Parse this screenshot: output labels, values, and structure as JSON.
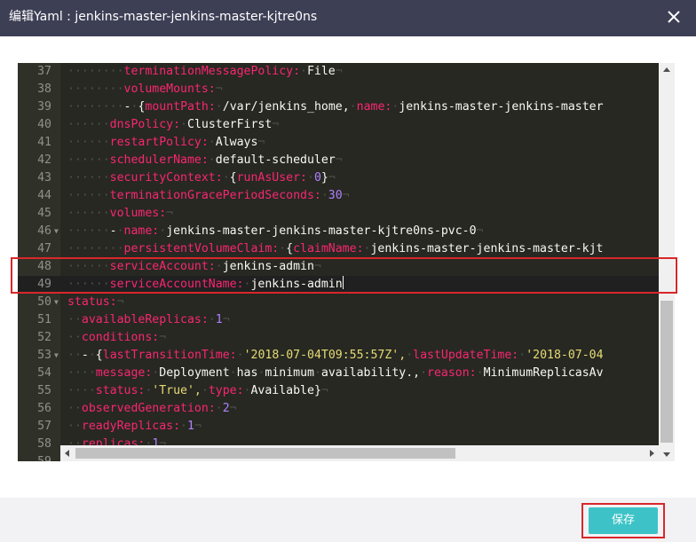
{
  "dialog": {
    "title": "编辑Yaml : jenkins-master-jenkins-master-kjtre0ns",
    "close_icon": "close-icon",
    "save_label": "保存",
    "accent_color": "#3dc3c7",
    "annotation_color": "#d9272a"
  },
  "editor": {
    "theme": "monokai",
    "cursor_line": "49",
    "lines": [
      {
        "num": "37",
        "fold": false,
        "partial": false,
        "tokens": [
          [
            "e",
            "········"
          ],
          [
            "k",
            "terminationMessagePolicy:"
          ],
          [
            "e",
            "·"
          ],
          [
            "v",
            "File"
          ],
          [
            "e",
            "¬"
          ]
        ]
      },
      {
        "num": "38",
        "fold": false,
        "partial": false,
        "tokens": [
          [
            "e",
            "········"
          ],
          [
            "k",
            "volumeMounts:"
          ],
          [
            "e",
            "¬"
          ]
        ]
      },
      {
        "num": "39",
        "fold": false,
        "partial": false,
        "tokens": [
          [
            "e",
            "········"
          ],
          [
            "p",
            "-"
          ],
          [
            "e",
            "·"
          ],
          [
            "p",
            "{"
          ],
          [
            "k",
            "mountPath:"
          ],
          [
            "e",
            "·"
          ],
          [
            "v",
            "/var/jenkins_home,"
          ],
          [
            "e",
            "·"
          ],
          [
            "k",
            "name:"
          ],
          [
            "e",
            "·"
          ],
          [
            "v",
            "jenkins-master-jenkins-master"
          ]
        ]
      },
      {
        "num": "40",
        "fold": false,
        "partial": false,
        "tokens": [
          [
            "e",
            "······"
          ],
          [
            "k",
            "dnsPolicy:"
          ],
          [
            "e",
            "·"
          ],
          [
            "v",
            "ClusterFirst"
          ],
          [
            "e",
            "¬"
          ]
        ]
      },
      {
        "num": "41",
        "fold": false,
        "partial": false,
        "tokens": [
          [
            "e",
            "······"
          ],
          [
            "k",
            "restartPolicy:"
          ],
          [
            "e",
            "·"
          ],
          [
            "v",
            "Always"
          ],
          [
            "e",
            "¬"
          ]
        ]
      },
      {
        "num": "42",
        "fold": false,
        "partial": false,
        "tokens": [
          [
            "e",
            "······"
          ],
          [
            "k",
            "schedulerName:"
          ],
          [
            "e",
            "·"
          ],
          [
            "v",
            "default-scheduler"
          ],
          [
            "e",
            "¬"
          ]
        ]
      },
      {
        "num": "43",
        "fold": false,
        "partial": false,
        "tokens": [
          [
            "e",
            "······"
          ],
          [
            "k",
            "securityContext:"
          ],
          [
            "e",
            "·"
          ],
          [
            "p",
            "{"
          ],
          [
            "k",
            "runAsUser:"
          ],
          [
            "e",
            "·"
          ],
          [
            "n",
            "0"
          ],
          [
            "p",
            "}"
          ],
          [
            "e",
            "¬"
          ]
        ]
      },
      {
        "num": "44",
        "fold": false,
        "partial": false,
        "tokens": [
          [
            "e",
            "······"
          ],
          [
            "k",
            "terminationGracePeriodSeconds:"
          ],
          [
            "e",
            "·"
          ],
          [
            "n",
            "30"
          ],
          [
            "e",
            "¬"
          ]
        ]
      },
      {
        "num": "45",
        "fold": false,
        "partial": false,
        "tokens": [
          [
            "e",
            "······"
          ],
          [
            "k",
            "volumes:"
          ],
          [
            "e",
            "¬"
          ]
        ]
      },
      {
        "num": "46",
        "fold": true,
        "partial": false,
        "tokens": [
          [
            "e",
            "······"
          ],
          [
            "p",
            "-"
          ],
          [
            "e",
            "·"
          ],
          [
            "k",
            "name:"
          ],
          [
            "e",
            "·"
          ],
          [
            "v",
            "jenkins-master-jenkins-master-kjtre0ns-pvc-0"
          ],
          [
            "e",
            "¬"
          ]
        ]
      },
      {
        "num": "47",
        "fold": false,
        "partial": false,
        "tokens": [
          [
            "e",
            "········"
          ],
          [
            "k",
            "persistentVolumeClaim:"
          ],
          [
            "e",
            "·"
          ],
          [
            "p",
            "{"
          ],
          [
            "k",
            "claimName:"
          ],
          [
            "e",
            "·"
          ],
          [
            "v",
            "jenkins-master-jenkins-master-kjt"
          ]
        ]
      },
      {
        "num": "48",
        "fold": false,
        "partial": false,
        "tokens": [
          [
            "e",
            "······"
          ],
          [
            "k",
            "serviceAccount:"
          ],
          [
            "e",
            "·"
          ],
          [
            "v",
            "jenkins-admin"
          ],
          [
            "e",
            "¬"
          ]
        ]
      },
      {
        "num": "49",
        "fold": false,
        "partial": false,
        "tokens": [
          [
            "e",
            "······"
          ],
          [
            "k",
            "serviceAccountName:"
          ],
          [
            "e",
            "·"
          ],
          [
            "v",
            "jenkins-admin"
          ]
        ]
      },
      {
        "num": "50",
        "fold": true,
        "partial": false,
        "tokens": [
          [
            "k",
            "status:"
          ],
          [
            "e",
            "¬"
          ]
        ]
      },
      {
        "num": "51",
        "fold": false,
        "partial": false,
        "tokens": [
          [
            "e",
            "··"
          ],
          [
            "k",
            "availableReplicas:"
          ],
          [
            "e",
            "·"
          ],
          [
            "n",
            "1"
          ],
          [
            "e",
            "¬"
          ]
        ]
      },
      {
        "num": "52",
        "fold": false,
        "partial": false,
        "tokens": [
          [
            "e",
            "··"
          ],
          [
            "k",
            "conditions:"
          ],
          [
            "e",
            "¬"
          ]
        ]
      },
      {
        "num": "53",
        "fold": true,
        "partial": false,
        "tokens": [
          [
            "e",
            "··"
          ],
          [
            "p",
            "-"
          ],
          [
            "e",
            "·"
          ],
          [
            "p",
            "{"
          ],
          [
            "k",
            "lastTransitionTime:"
          ],
          [
            "e",
            "·"
          ],
          [
            "s",
            "'2018-07-04T09:55:57Z',"
          ],
          [
            "e",
            "·"
          ],
          [
            "k",
            "lastUpdateTime:"
          ],
          [
            "e",
            "·"
          ],
          [
            "s",
            "'2018-07-04"
          ]
        ]
      },
      {
        "num": "54",
        "fold": false,
        "partial": false,
        "tokens": [
          [
            "e",
            "····"
          ],
          [
            "k",
            "message:"
          ],
          [
            "e",
            "·"
          ],
          [
            "v",
            "Deployment"
          ],
          [
            "e",
            "·"
          ],
          [
            "v",
            "has"
          ],
          [
            "e",
            "·"
          ],
          [
            "v",
            "minimum"
          ],
          [
            "e",
            "·"
          ],
          [
            "v",
            "availability.,"
          ],
          [
            "e",
            "·"
          ],
          [
            "k",
            "reason:"
          ],
          [
            "e",
            "·"
          ],
          [
            "v",
            "MinimumReplicasAv"
          ]
        ]
      },
      {
        "num": "55",
        "fold": false,
        "partial": false,
        "tokens": [
          [
            "e",
            "····"
          ],
          [
            "k",
            "status:"
          ],
          [
            "e",
            "·"
          ],
          [
            "s",
            "'True',"
          ],
          [
            "e",
            "·"
          ],
          [
            "k",
            "type:"
          ],
          [
            "e",
            "·"
          ],
          [
            "v",
            "Available"
          ],
          [
            "p",
            "}"
          ],
          [
            "e",
            "¬"
          ]
        ]
      },
      {
        "num": "56",
        "fold": false,
        "partial": false,
        "tokens": [
          [
            "e",
            "··"
          ],
          [
            "k",
            "observedGeneration:"
          ],
          [
            "e",
            "·"
          ],
          [
            "n",
            "2"
          ],
          [
            "e",
            "¬"
          ]
        ]
      },
      {
        "num": "57",
        "fold": false,
        "partial": false,
        "tokens": [
          [
            "e",
            "··"
          ],
          [
            "k",
            "readyReplicas:"
          ],
          [
            "e",
            "·"
          ],
          [
            "n",
            "1"
          ],
          [
            "e",
            "¬"
          ]
        ]
      },
      {
        "num": "58",
        "fold": false,
        "partial": false,
        "tokens": [
          [
            "e",
            "··"
          ],
          [
            "k",
            "replicas:"
          ],
          [
            "e",
            "·"
          ],
          [
            "n",
            "1"
          ],
          [
            "e",
            "¬"
          ]
        ]
      },
      {
        "num": "59",
        "fold": false,
        "partial": true,
        "tokens": []
      }
    ]
  },
  "scrollbars": {
    "vertical_icons": [
      "arrow-up-icon",
      "arrow-down-icon"
    ],
    "horizontal_icons": [
      "arrow-left-icon",
      "arrow-right-icon"
    ]
  }
}
